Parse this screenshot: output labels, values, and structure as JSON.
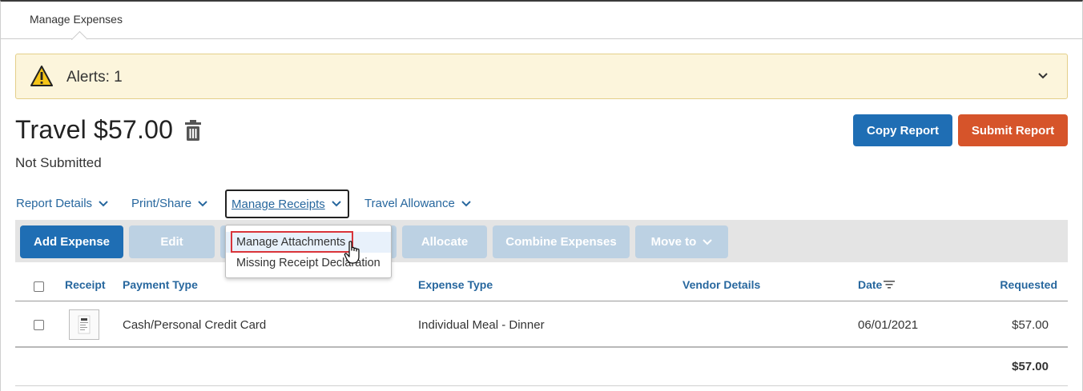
{
  "tabs": [
    {
      "label": "Manage Expenses",
      "active": true
    }
  ],
  "alert": {
    "text": "Alerts: 1"
  },
  "report": {
    "title": "Travel $57.00",
    "status": "Not Submitted"
  },
  "header_buttons": {
    "copy": "Copy Report",
    "submit": "Submit Report"
  },
  "menu": {
    "report_details": "Report Details",
    "print_share": "Print/Share",
    "manage_receipts": "Manage Receipts",
    "travel_allowance": "Travel Allowance"
  },
  "toolbar": {
    "add_expense": "Add Expense",
    "edit": "Edit",
    "allocate": "Allocate",
    "combine_expenses": "Combine Expenses",
    "move_to": "Move to"
  },
  "dropdown": {
    "items": [
      "Manage Attachments",
      "Missing Receipt Declaration"
    ],
    "highlighted": "Manage Attachments"
  },
  "table": {
    "columns": {
      "receipt": "Receipt",
      "payment_type": "Payment Type",
      "expense_type": "Expense Type",
      "vendor_details": "Vendor Details",
      "date": "Date",
      "requested": "Requested"
    },
    "rows": [
      {
        "payment_type": "Cash/Personal Credit Card",
        "expense_type": "Individual Meal - Dinner",
        "vendor_details": "",
        "date": "06/01/2021",
        "requested": "$57.00"
      }
    ],
    "total": "$57.00"
  },
  "colors": {
    "primary": "#1f6eb4",
    "danger": "#d6542a",
    "link": "#27679e",
    "alert_bg": "#fcf5dc"
  }
}
